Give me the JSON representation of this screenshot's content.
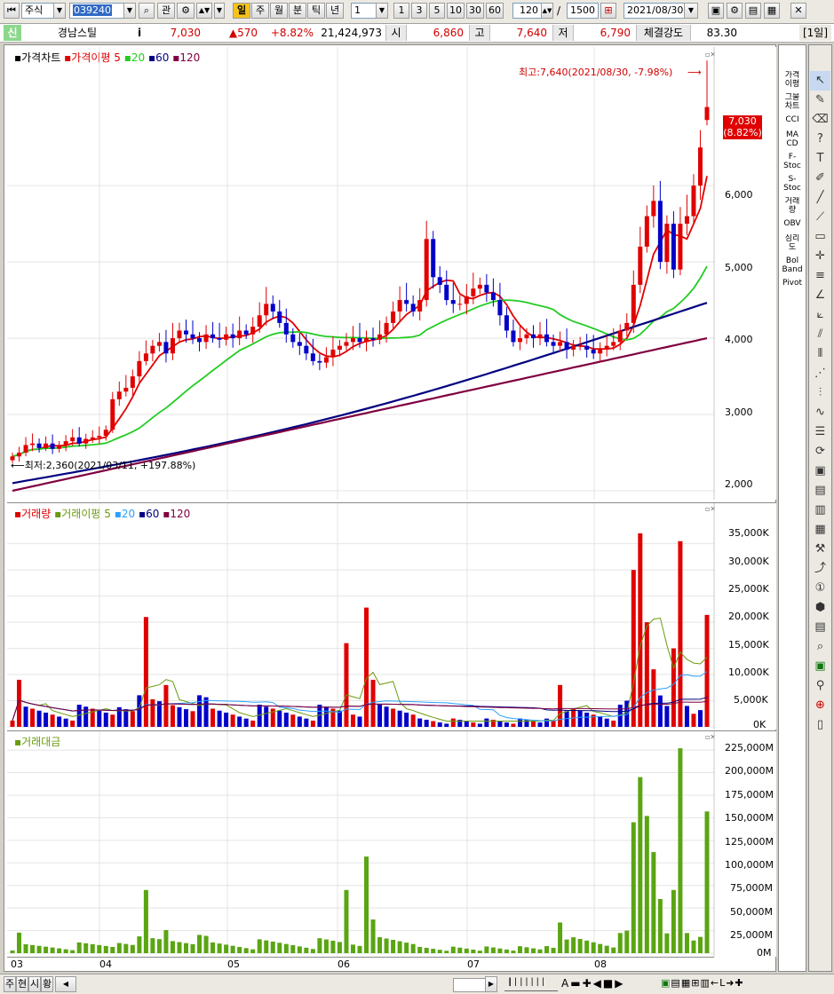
{
  "toolbar": {
    "market": "주식",
    "code": "039240",
    "gwan": "관",
    "period_day": "일",
    "period_week": "주",
    "period_month": "월",
    "period_min": "분",
    "period_tick": "틱",
    "period_year": "년",
    "period_n": "1",
    "opts": [
      "1",
      "3",
      "5",
      "10",
      "30",
      "60"
    ],
    "count": "120",
    "total": "1500",
    "date": "2021/08/30",
    "tag": "[1일]"
  },
  "info": {
    "badge": "신",
    "name": "경남스틸",
    "info_icon": "i",
    "price": "7,030",
    "change": "▲570",
    "pct": "+8.82%",
    "volume": "21,424,973",
    "open_lbl": "시",
    "open": "6,860",
    "high_lbl": "고",
    "high": "7,640",
    "low_lbl": "저",
    "low": "6,790",
    "strength_lbl": "체결강도",
    "strength": "83.30"
  },
  "price_panel": {
    "legend_title": "가격차트",
    "legend_ma_label": "가격이평",
    "legend_ma": [
      "5",
      "20",
      "60",
      "120"
    ],
    "ma_colors": [
      "#e00000",
      "#22cc22",
      "#000080",
      "#800040"
    ],
    "high_annot": "최고:7,640(2021/08/30, -7.98%)",
    "low_annot": "최저:2,360(2021/03/11, +197.88%)",
    "last_price": "7,030",
    "last_pct": "(8.82%)",
    "y_ticks": [
      "6,000",
      "5,000",
      "4,000",
      "3,000",
      "2,000"
    ]
  },
  "volume_panel": {
    "legend_title": "거래량",
    "legend_ma_label": "거래이평",
    "legend_ma": [
      "5",
      "20",
      "60",
      "120"
    ],
    "y_ticks": [
      "35,000K",
      "30,000K",
      "25,000K",
      "20,000K",
      "15,000K",
      "10,000K",
      "5,000K",
      "0K"
    ]
  },
  "amount_panel": {
    "legend_title": "거래대금",
    "y_ticks": [
      "225,000M",
      "200,000M",
      "175,000M",
      "150,000M",
      "125,000M",
      "100,000M",
      "75,000M",
      "50,000M",
      "25,000M",
      "0M"
    ]
  },
  "x_labels": [
    "03",
    "04",
    "05",
    "06",
    "07",
    "08"
  ],
  "right_tools": [
    "가격\n이평",
    "그물\n차트",
    "CCI",
    "MA\nCD",
    "F-\nStoc",
    "S-\nStoc",
    "거래\n량",
    "OBV",
    "심리\n도",
    "Bol\nBand",
    "Pivot"
  ],
  "status_tabs": [
    "주",
    "현",
    "시",
    "황"
  ],
  "chart_data": [
    {
      "type": "candlestick",
      "title": "가격차트",
      "ylim": [
        2000,
        7700
      ],
      "x_ticks": [
        "03",
        "04",
        "05",
        "06",
        "07",
        "08"
      ],
      "close_series": [
        2450,
        2500,
        2600,
        2620,
        2560,
        2620,
        2550,
        2600,
        2650,
        2700,
        2620,
        2680,
        2700,
        2720,
        2800,
        3200,
        3300,
        3350,
        3500,
        3700,
        3800,
        3900,
        3950,
        3800,
        4000,
        4100,
        4050,
        4000,
        3950,
        4050,
        4000,
        3980,
        4050,
        4000,
        4100,
        4050,
        4150,
        4300,
        4450,
        4350,
        4200,
        4050,
        3950,
        3900,
        3800,
        3700,
        3680,
        3750,
        3850,
        3900,
        3950,
        4000,
        3950,
        4000,
        3980,
        4050,
        4200,
        4350,
        4500,
        4450,
        4350,
        4500,
        5300,
        4800,
        4700,
        4500,
        4450,
        4450,
        4550,
        4650,
        4700,
        4600,
        4500,
        4300,
        4100,
        3950,
        4000,
        4050,
        4000,
        4050,
        3950,
        3900,
        3950,
        3850,
        3900,
        3900,
        3850,
        3800,
        3850,
        3900,
        3950,
        4100,
        4200,
        4700,
        5200,
        5600,
        5800,
        5000,
        5500,
        4900,
        5500,
        5600,
        6000,
        6500,
        7030
      ],
      "ma_series": [
        {
          "name": "5",
          "last": 6100
        },
        {
          "name": "20",
          "last": 4950
        },
        {
          "name": "60",
          "last": 4400
        },
        {
          "name": "120",
          "last": 4000
        }
      ],
      "high": 7640,
      "low": 2360
    },
    {
      "type": "bar",
      "title": "거래량",
      "unit": "K",
      "ylim": [
        0,
        38000
      ],
      "notable": [
        {
          "x": "03 start",
          "value": 9000
        },
        {
          "x": "04",
          "value": 21000
        },
        {
          "x": "05",
          "value": 22800
        },
        {
          "x": "06 late",
          "value": 30000
        },
        {
          "x": "08 late",
          "value": 37000
        },
        {
          "x": "08 late",
          "value": 35500
        },
        {
          "x": "08/30",
          "value": 21400
        }
      ]
    },
    {
      "type": "bar",
      "title": "거래대금",
      "unit": "M",
      "ylim": [
        0,
        230000
      ],
      "notable": [
        {
          "x": "04",
          "value": 70000
        },
        {
          "x": "05",
          "value": 107000
        },
        {
          "x": "06 late",
          "value": 152000
        },
        {
          "x": "08 late",
          "value": 195000
        },
        {
          "x": "08 late",
          "value": 227000
        },
        {
          "x": "08/30",
          "value": 157000
        }
      ]
    }
  ]
}
